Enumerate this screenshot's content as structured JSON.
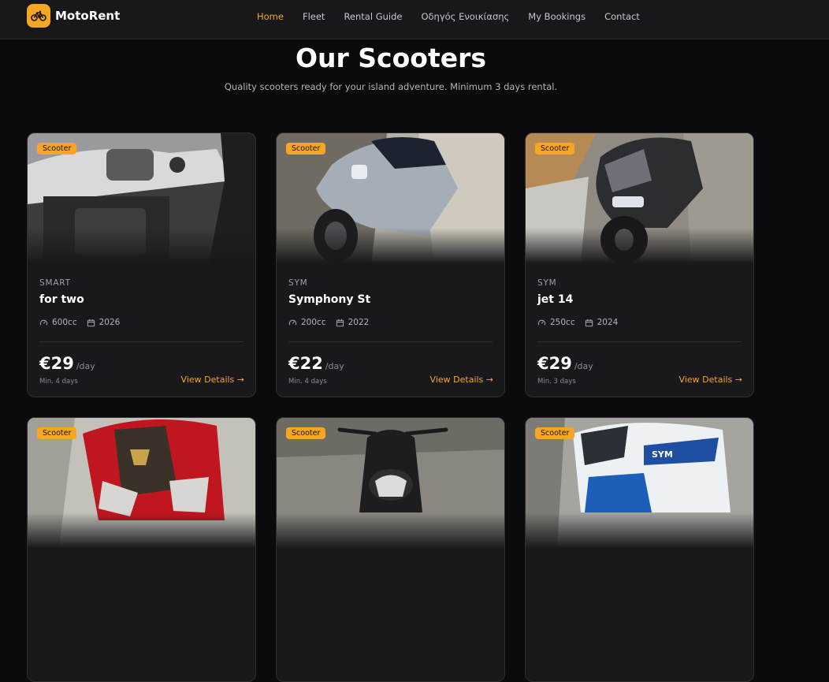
{
  "brand": {
    "name": "MotoRent"
  },
  "nav": [
    "Home",
    "Fleet",
    "Rental Guide",
    "Οδηγός Ενοικίασης",
    "My Bookings",
    "Contact"
  ],
  "hero": {
    "title": "Our Scooters",
    "subtitle": "Quality scooters ready for your island adventure. Minimum 3 days rental."
  },
  "cards": [
    {
      "badge": "Scooter",
      "make": "SMART",
      "model": "for two",
      "cc": "600cc",
      "year": "2026",
      "price": "€29",
      "unit": "/day",
      "min": "Min. 4 days",
      "cta": "View Details →"
    },
    {
      "badge": "Scooter",
      "make": "SYM",
      "model": "Symphony St",
      "cc": "200cc",
      "year": "2022",
      "price": "€22",
      "unit": "/day",
      "min": "Min. 4 days",
      "cta": "View Details →"
    },
    {
      "badge": "Scooter",
      "make": "SYM",
      "model": "jet 14",
      "cc": "250cc",
      "year": "2024",
      "price": "€29",
      "unit": "/day",
      "min": "Min. 3 days",
      "cta": "View Details →"
    },
    {
      "badge": "Scooter"
    },
    {
      "badge": "Scooter"
    },
    {
      "badge": "Scooter"
    }
  ],
  "colors": {
    "accent": "#f5a623",
    "background": "#0b0a0d",
    "card": "#19181c"
  },
  "icons": {
    "logo": "bicycle-icon",
    "engine": "gauge-icon",
    "year": "calendar-icon"
  }
}
